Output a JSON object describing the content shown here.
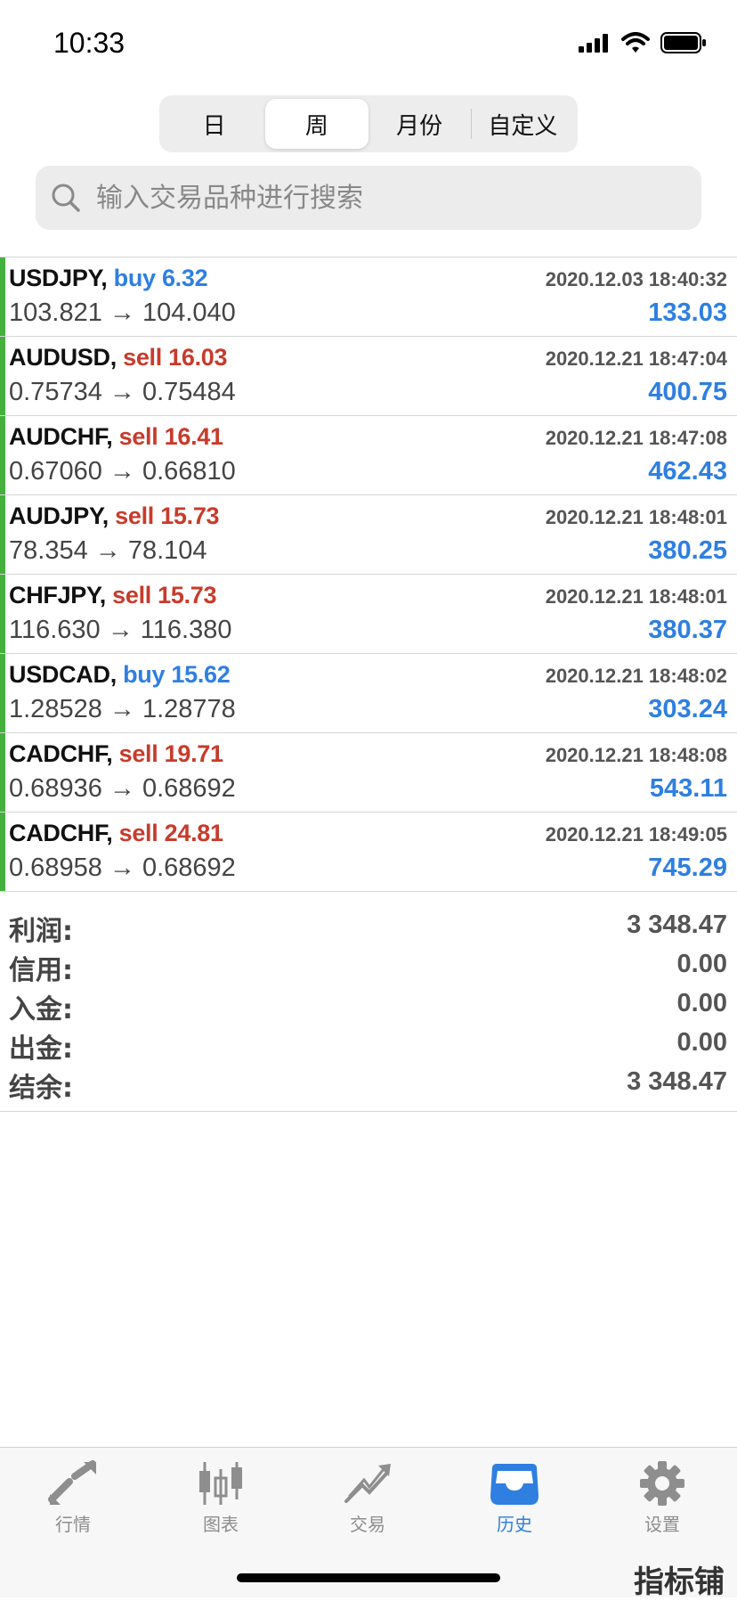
{
  "status": {
    "time": "10:33"
  },
  "period_tabs": [
    {
      "label": "日",
      "active": false
    },
    {
      "label": "周",
      "active": true
    },
    {
      "label": "月份",
      "active": false
    },
    {
      "label": "自定义",
      "active": false
    }
  ],
  "search": {
    "placeholder": "输入交易品种进行搜索"
  },
  "trades": [
    {
      "symbol": "USDJPY,",
      "side": "buy 6.32",
      "type": "buy",
      "time": "2020.12.03 18:40:32",
      "prices": "103.821 → 104.040",
      "profit": "133.03"
    },
    {
      "symbol": "AUDUSD,",
      "side": "sell 16.03",
      "type": "sell",
      "time": "2020.12.21 18:47:04",
      "prices": "0.75734 → 0.75484",
      "profit": "400.75"
    },
    {
      "symbol": "AUDCHF,",
      "side": "sell 16.41",
      "type": "sell",
      "time": "2020.12.21 18:47:08",
      "prices": "0.67060 → 0.66810",
      "profit": "462.43"
    },
    {
      "symbol": "AUDJPY,",
      "side": "sell 15.73",
      "type": "sell",
      "time": "2020.12.21 18:48:01",
      "prices": "78.354 → 78.104",
      "profit": "380.25"
    },
    {
      "symbol": "CHFJPY,",
      "side": "sell 15.73",
      "type": "sell",
      "time": "2020.12.21 18:48:01",
      "prices": "116.630 → 116.380",
      "profit": "380.37"
    },
    {
      "symbol": "USDCAD,",
      "side": "buy 15.62",
      "type": "buy",
      "time": "2020.12.21 18:48:02",
      "prices": "1.28528 → 1.28778",
      "profit": "303.24"
    },
    {
      "symbol": "CADCHF,",
      "side": "sell 19.71",
      "type": "sell",
      "time": "2020.12.21 18:48:08",
      "prices": "0.68936 → 0.68692",
      "profit": "543.11"
    },
    {
      "symbol": "CADCHF,",
      "side": "sell 24.81",
      "type": "sell",
      "time": "2020.12.21 18:49:05",
      "prices": "0.68958 → 0.68692",
      "profit": "745.29"
    }
  ],
  "summary": [
    {
      "label": "利润:",
      "value": "3 348.47"
    },
    {
      "label": "信用:",
      "value": "0.00"
    },
    {
      "label": "入金:",
      "value": "0.00"
    },
    {
      "label": "出金:",
      "value": "0.00"
    },
    {
      "label": "结余:",
      "value": "3 348.47"
    }
  ],
  "tabbar": [
    {
      "label": "行情",
      "icon": "quotes-arrows-icon",
      "active": false
    },
    {
      "label": "图表",
      "icon": "candlestick-chart-icon",
      "active": false
    },
    {
      "label": "交易",
      "icon": "trade-trend-icon",
      "active": false
    },
    {
      "label": "历史",
      "icon": "history-inbox-icon",
      "active": true
    },
    {
      "label": "设置",
      "icon": "gear-icon",
      "active": false
    }
  ],
  "watermark": "指标铺",
  "colors": {
    "buy": "#2f7fe1",
    "sell": "#c83b2c",
    "profit": "#2f7fe1",
    "row_marker": "#45b03e",
    "active_tab": "#2f7fe1"
  }
}
